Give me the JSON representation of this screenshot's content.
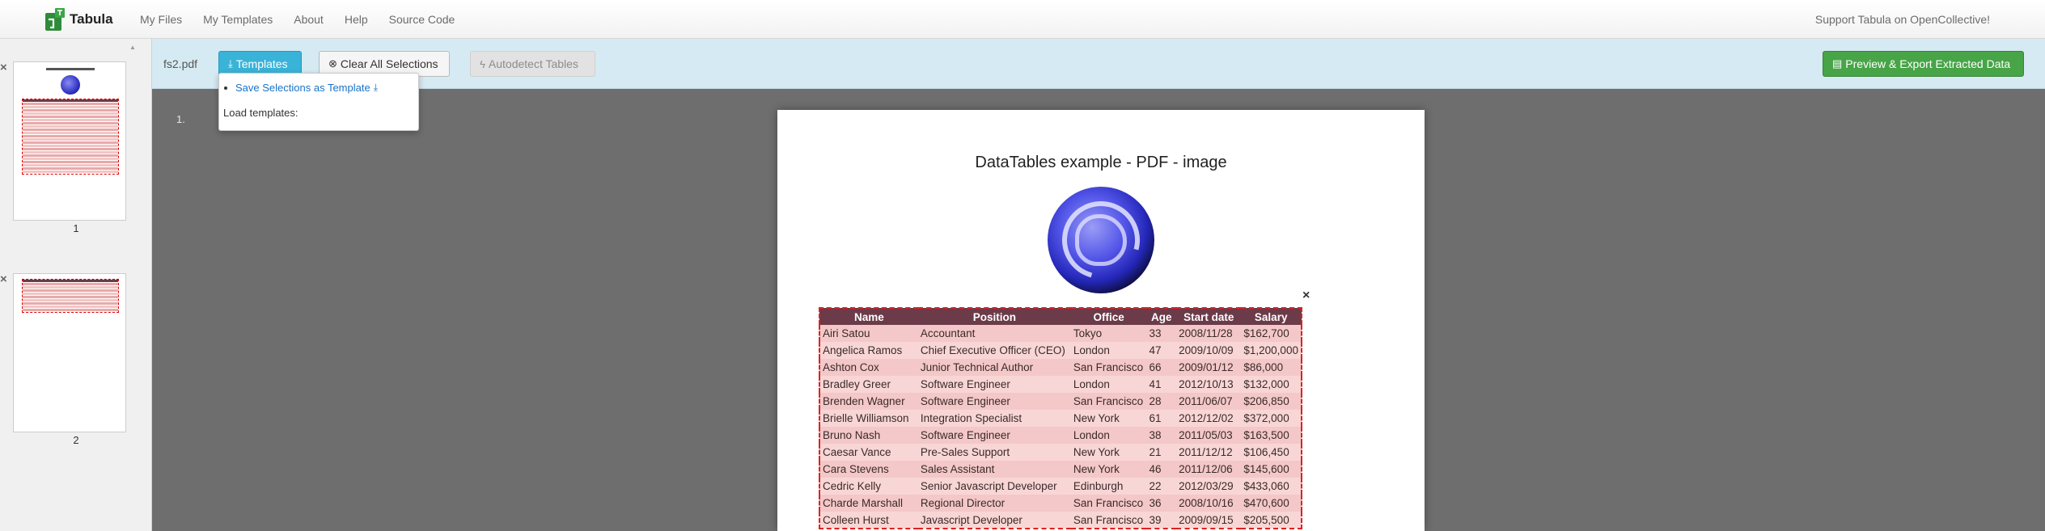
{
  "navbar": {
    "brand": "Tabula",
    "links": [
      "My Files",
      "My Templates",
      "About",
      "Help",
      "Source Code"
    ],
    "right_link": "Support Tabula on OpenCollective!"
  },
  "sidebar": {
    "pages": [
      {
        "number": "1",
        "close_icon": "×"
      },
      {
        "number": "2",
        "close_icon": "×"
      }
    ]
  },
  "toolbar": {
    "filename": "fs2.pdf",
    "templates_label": "Templates",
    "clear_label": "Clear All Selections",
    "autodetect_label": "Autodetect Tables",
    "export_label": "Preview & Export Extracted Data"
  },
  "dropdown": {
    "save_link": "Save Selections as Template",
    "load_label": "Load templates:"
  },
  "workspace": {
    "page_marker": "1.",
    "selection_close": "×"
  },
  "document": {
    "title": "DataTables example - PDF - image",
    "table": {
      "headers": [
        "Name",
        "Position",
        "Office",
        "Age",
        "Start date",
        "Salary"
      ],
      "rows": [
        [
          "Airi Satou",
          "Accountant",
          "Tokyo",
          "33",
          "2008/11/28",
          "$162,700"
        ],
        [
          "Angelica Ramos",
          "Chief Executive Officer (CEO)",
          "London",
          "47",
          "2009/10/09",
          "$1,200,000"
        ],
        [
          "Ashton Cox",
          "Junior Technical Author",
          "San Francisco",
          "66",
          "2009/01/12",
          "$86,000"
        ],
        [
          "Bradley Greer",
          "Software Engineer",
          "London",
          "41",
          "2012/10/13",
          "$132,000"
        ],
        [
          "Brenden Wagner",
          "Software Engineer",
          "San Francisco",
          "28",
          "2011/06/07",
          "$206,850"
        ],
        [
          "Brielle Williamson",
          "Integration Specialist",
          "New York",
          "61",
          "2012/12/02",
          "$372,000"
        ],
        [
          "Bruno Nash",
          "Software Engineer",
          "London",
          "38",
          "2011/05/03",
          "$163,500"
        ],
        [
          "Caesar Vance",
          "Pre-Sales Support",
          "New York",
          "21",
          "2011/12/12",
          "$106,450"
        ],
        [
          "Cara Stevens",
          "Sales Assistant",
          "New York",
          "46",
          "2011/12/06",
          "$145,600"
        ],
        [
          "Cedric Kelly",
          "Senior Javascript Developer",
          "Edinburgh",
          "22",
          "2012/03/29",
          "$433,060"
        ],
        [
          "Charde Marshall",
          "Regional Director",
          "San Francisco",
          "36",
          "2008/10/16",
          "$470,600"
        ],
        [
          "Colleen Hurst",
          "Javascript Developer",
          "San Francisco",
          "39",
          "2009/09/15",
          "$205,500"
        ]
      ]
    }
  },
  "colors": {
    "toolbar_bg": "#d6eaf3",
    "templates_button": "#39b3d7",
    "export_button": "#47a447",
    "table_header": "#6b3b49",
    "selection_border": "#dd2222"
  }
}
